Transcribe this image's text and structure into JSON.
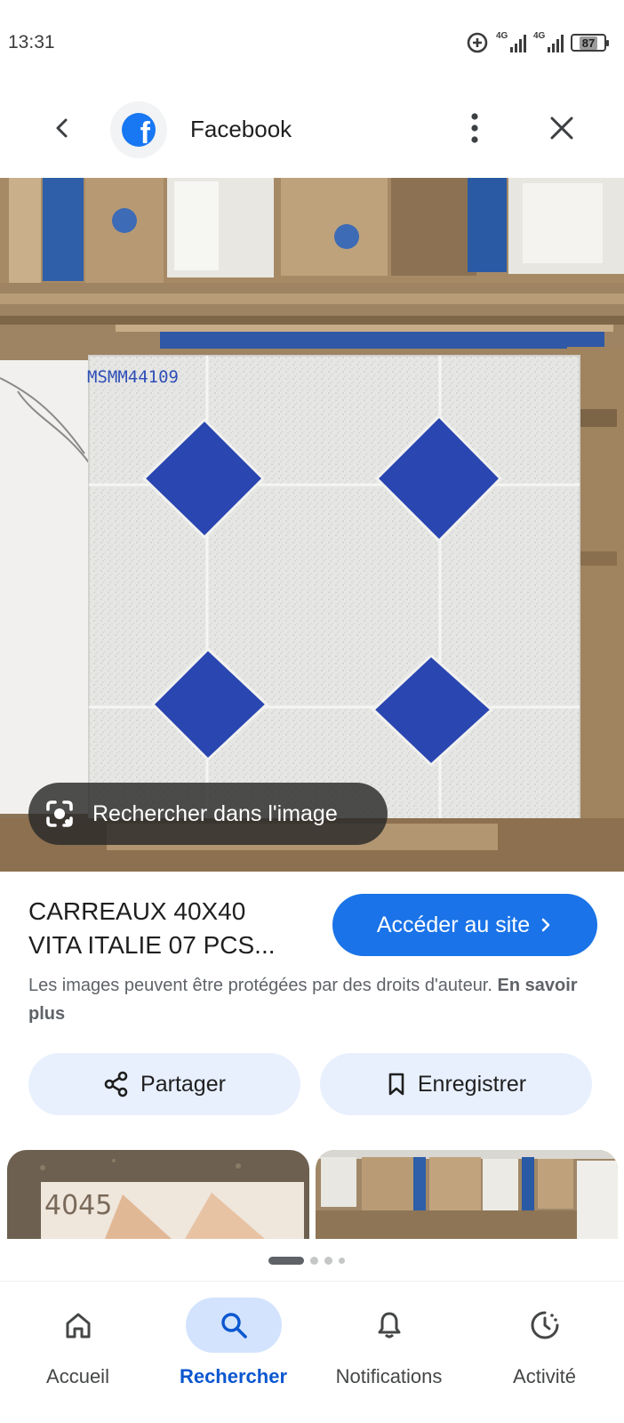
{
  "status_bar": {
    "time": "13:31",
    "network_1": "4G",
    "network_2": "4G",
    "battery": "87"
  },
  "header": {
    "back_icon": "chevron-left-icon",
    "source_logo": "facebook-logo",
    "source_name": "Facebook",
    "more_icon": "more-vertical-icon",
    "close_icon": "close-icon"
  },
  "image": {
    "handwritten_code": "MSMM44109",
    "lens_label": "Rechercher dans l'image"
  },
  "result": {
    "title": "CARREAUX 40X40\nVITA ITALIE 07 PCS...",
    "visit_label": "Accéder au site",
    "copyright_text": "Les images peuvent être protégées par des droits d'auteur.",
    "learn_more": "En savoir plus"
  },
  "actions": {
    "share_label": "Partager",
    "save_label": "Enregistrer"
  },
  "related": {
    "thumb1_text": "4045"
  },
  "bottom_nav": {
    "items": [
      {
        "label": "Accueil",
        "icon": "home-icon"
      },
      {
        "label": "Rechercher",
        "icon": "search-icon"
      },
      {
        "label": "Notifications",
        "icon": "bell-icon"
      },
      {
        "label": "Activité",
        "icon": "activity-icon"
      }
    ]
  },
  "colors": {
    "accent": "#1a73e8",
    "pill_bg": "#e8f0fe",
    "tile_blue": "#2a46b0",
    "facebook": "#1877f2"
  }
}
